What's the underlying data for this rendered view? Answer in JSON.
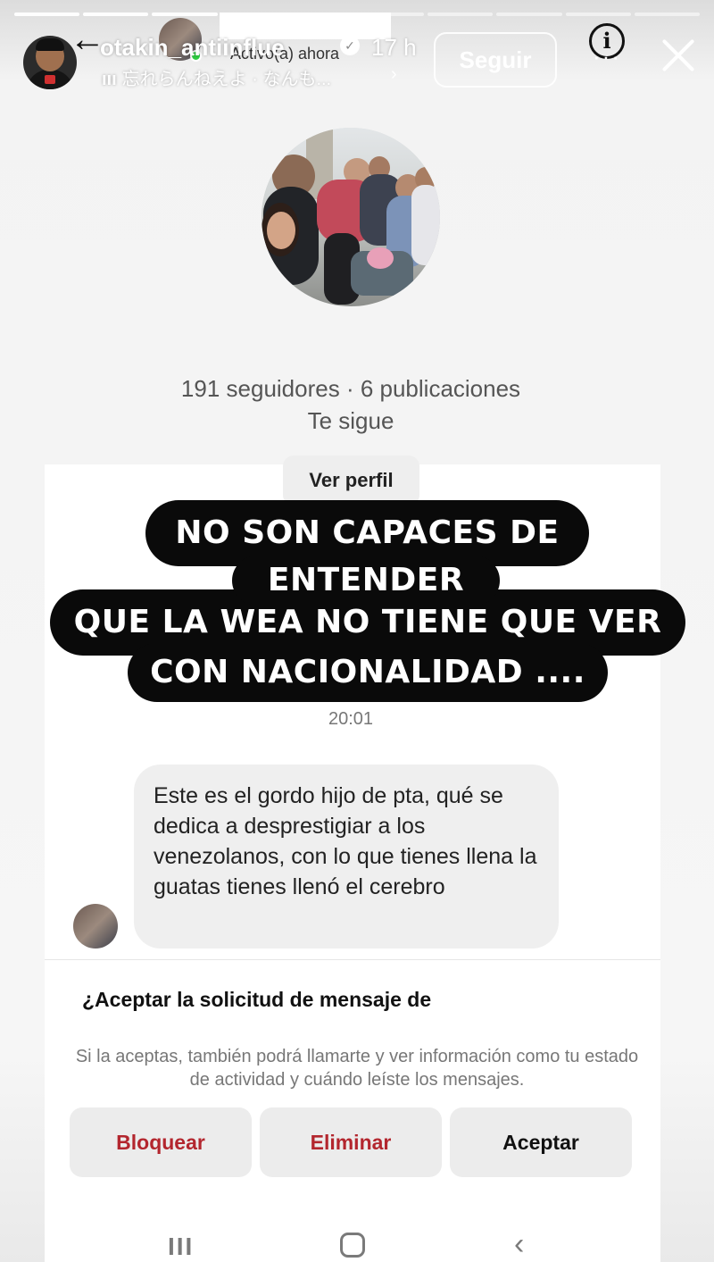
{
  "story": {
    "username": "otakin_antiinflue",
    "time_ago": "17 h",
    "music": "忘れらんねえよ · なんも...",
    "follow_label": "Seguir",
    "progress_segments": 10,
    "progress_done": 3
  },
  "dm": {
    "status": "Activo(a) ahora",
    "stats": "191 seguidores · 6 publicaciones",
    "follows_you": "Te sigue",
    "view_profile_label": "Ver perfil",
    "message_time": "20:01",
    "message_text": "Este es el gordo hijo de pta,  qué se dedica a desprestigiar a los venezolanos,  con lo que tienes llena la guatas tienes llenó el cerebro",
    "accept_question": "¿Aceptar la solicitud de mensaje de",
    "accept_note": "Si la aceptas, también podrá llamarte y ver información como tu estado de actividad y cuándo leíste los mensajes.",
    "actions": {
      "block": "Bloquear",
      "delete": "Eliminar",
      "accept": "Aceptar"
    }
  },
  "caption": {
    "line1": "NO SON CAPACES DE",
    "line2": "ENTENDER",
    "line3": "QUE LA WEA NO TIENE QUE VER",
    "line4": "CON NACIONALIDAD ...."
  },
  "icons": {
    "back": "arrow-left-icon",
    "info": "info-icon",
    "close": "close-icon",
    "music": "music-bars-icon",
    "verified": "verified-badge-icon"
  },
  "colors": {
    "danger": "#b3262e",
    "online": "#2ecc40",
    "caption_bg": "#0a0a0a"
  }
}
